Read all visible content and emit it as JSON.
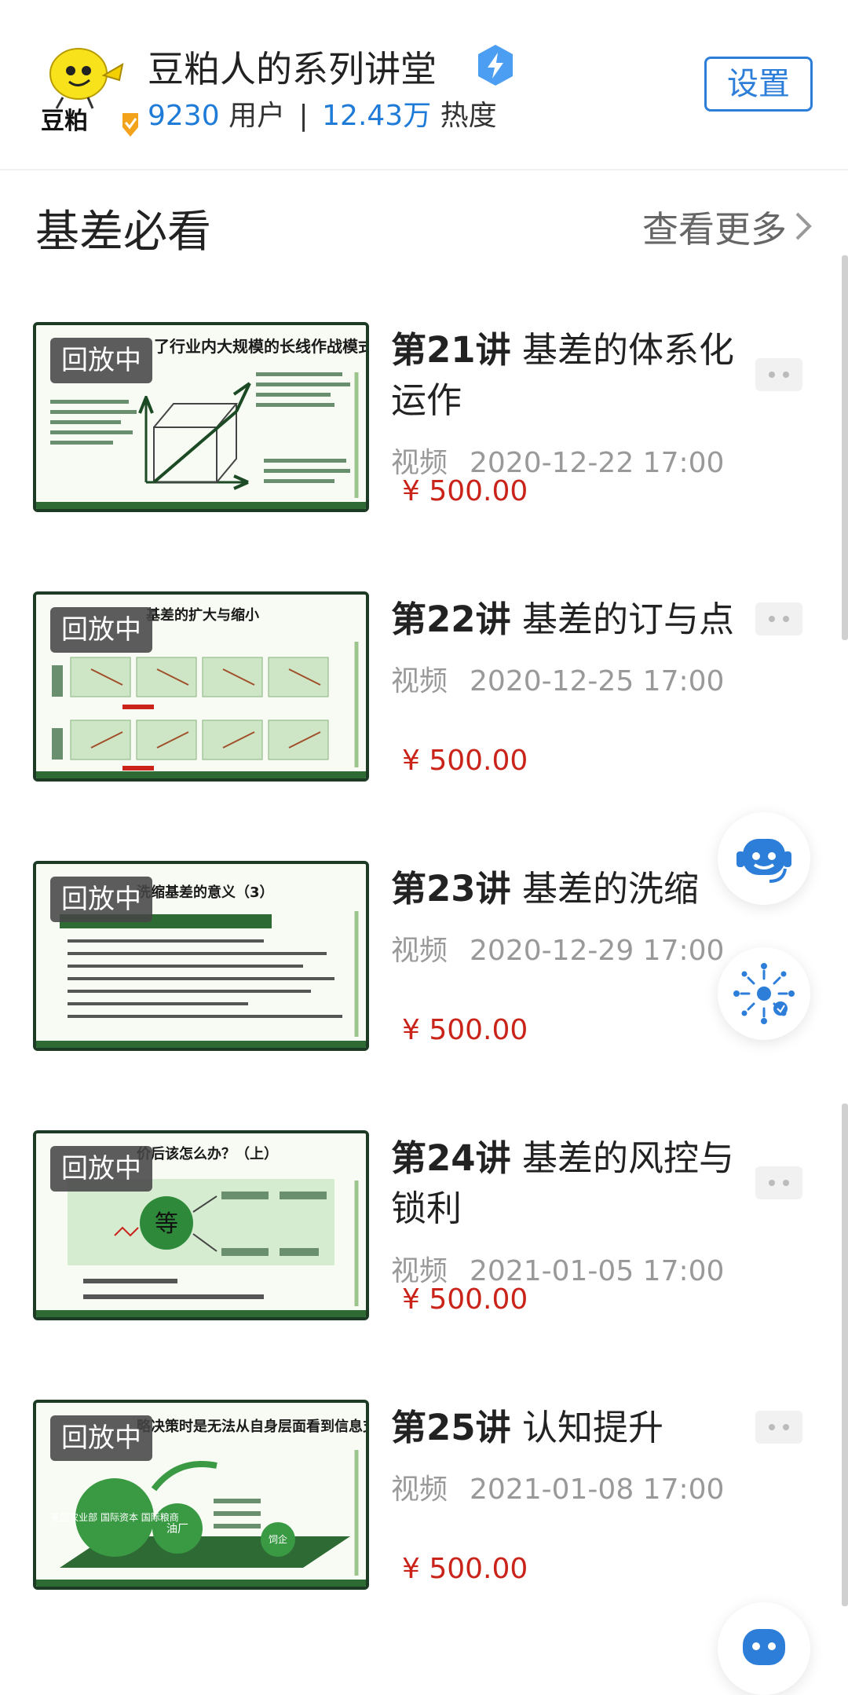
{
  "header": {
    "logo_text": "豆粕",
    "title": "豆粕人的系列讲堂",
    "users_count": "9230",
    "users_label": "用户",
    "separator": "|",
    "heat_count": "12.43万",
    "heat_label": "热度",
    "settings_label": "设置"
  },
  "section": {
    "title": "基差必看",
    "see_more": "查看更多"
  },
  "items": [
    {
      "badge": "回放中",
      "num": "第21讲",
      "title": "基差的体系化运作",
      "type": "视频",
      "datetime": "2020-12-22 17:00",
      "price": "¥ 500.00",
      "thumb_heading": "了行业内大规模的长线作战模式"
    },
    {
      "badge": "回放中",
      "num": "第22讲",
      "title": "基差的订与点",
      "type": "视频",
      "datetime": "2020-12-25 17:00",
      "price": "¥ 500.00",
      "thumb_heading": "基差的扩大与缩小"
    },
    {
      "badge": "回放中",
      "num": "第23讲",
      "title": "基差的洗缩",
      "type": "视频",
      "datetime": "2020-12-29 17:00",
      "price": "¥ 500.00",
      "thumb_heading": "洗缩基差的意义（3）"
    },
    {
      "badge": "回放中",
      "num": "第24讲",
      "title": "基差的风控与锁利",
      "type": "视频",
      "datetime": "2021-01-05 17:00",
      "price": "¥ 500.00",
      "thumb_heading": "价后该怎么办？（上）",
      "thumb_center": "等"
    },
    {
      "badge": "回放中",
      "num": "第25讲",
      "title": "认知提升",
      "type": "视频",
      "datetime": "2021-01-08 17:00",
      "price": "¥ 500.00",
      "thumb_heading": "略决策时是无法从自身层面看到信息支撑的",
      "thumb_nodes": [
        "美国农业部 国际资本 国际粮商",
        "油厂",
        "饲企"
      ]
    }
  ],
  "icons": {
    "verified": "verified-badge-icon",
    "chevron": "chevron-right-icon",
    "support": "customer-service-icon",
    "assistant": "ai-assistant-icon"
  },
  "colors": {
    "accent": "#1f7bd8",
    "price": "#c9231a",
    "badge_bg": "#464646",
    "thumb_green": "#2e6b34"
  }
}
